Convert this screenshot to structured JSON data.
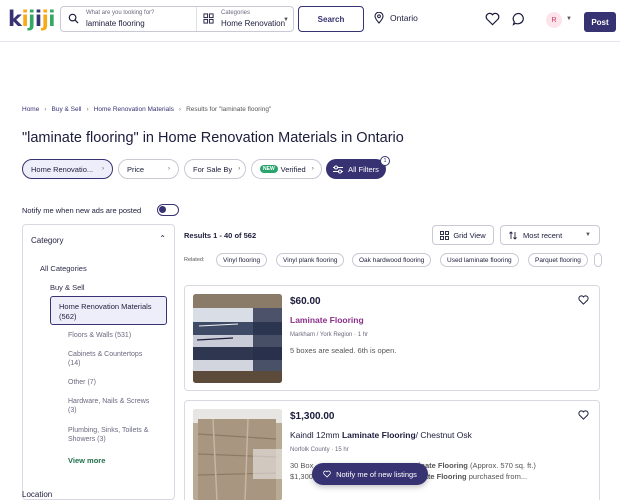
{
  "brand": {
    "letters": [
      "k",
      "i",
      "j",
      "i",
      "j",
      "i"
    ],
    "letter_colors": [
      "#373373",
      "#f8aa17",
      "#37a864",
      "#373373",
      "#f8aa17",
      "#37a864"
    ]
  },
  "search": {
    "label": "What are you looking for?",
    "query": "laminate flooring",
    "category_label": "Categories",
    "category_value": "Home Renovation",
    "button": "Search",
    "location": "Ontario"
  },
  "user": {
    "initial": "R"
  },
  "header": {
    "post_label": "Post"
  },
  "breadcrumb": [
    "Home",
    "Buy & Sell",
    "Home Renovation Materials",
    "Results for \"laminate flooring\""
  ],
  "page_title": "\"laminate flooring\" in Home Renovation Materials in Ontario",
  "filters": {
    "category": "Home Renovatio...",
    "price": "Price",
    "for_sale_by": "For Sale By",
    "verified_badge": "NEW",
    "verified": "Verified",
    "all_filters": "All Filters",
    "all_filters_count": "1"
  },
  "notify_label": "Notify me when new ads are posted",
  "sidebar": {
    "heading": "Category",
    "all": "All Categories",
    "parent": "Buy & Sell",
    "selected": "Home Renovation Materials",
    "selected_count": "(562)",
    "subs": [
      {
        "label": "Floors & Walls (531)"
      },
      {
        "label": "Cabinets & Countertops",
        "count": "(14)"
      },
      {
        "label": "Other (7)"
      },
      {
        "label": "Hardware, Nails & Screws",
        "count": "(3)"
      },
      {
        "label": "Plumbing, Sinks, Toilets &",
        "label2": "Showers (3)"
      }
    ],
    "view_more": "View more",
    "location_heading": "Location"
  },
  "results": {
    "summary": "Results 1 - 40 of 562",
    "grid_view": "Grid View",
    "sort": "Most recent",
    "related_label": "Related:",
    "related": [
      "Vinyl flooring",
      "Vinyl plank flooring",
      "Oak hardwood flooring",
      "Used laminate flooring",
      "Parquet flooring"
    ]
  },
  "listings": [
    {
      "price": "$60.00",
      "title": "Laminate Flooring",
      "location": "Markham / York Region",
      "age": "1 hr",
      "desc": "5 boxes are sealed. 6th is open."
    },
    {
      "price": "$1,300.00",
      "title_plain": "Kaindl 12mm ",
      "title_bold": "Laminate Flooring",
      "title_tail": "/ Chestnut Osk",
      "location": "Norfolk County",
      "age": "15 hr",
      "desc1_a": "30 Box",
      "desc1_bold": "aminate Flooring",
      "desc1_tail": " (Approx. 570 sq. ft.)",
      "desc2_a": "$1,300",
      "desc2_bold": "inate Flooring",
      "desc2_tail": " purchased from..."
    }
  ],
  "float_notify": "Notify me of new listings",
  "colors": {
    "primary": "#373373",
    "accent_green": "#37a864",
    "purple_link": "#8c2f8a"
  }
}
